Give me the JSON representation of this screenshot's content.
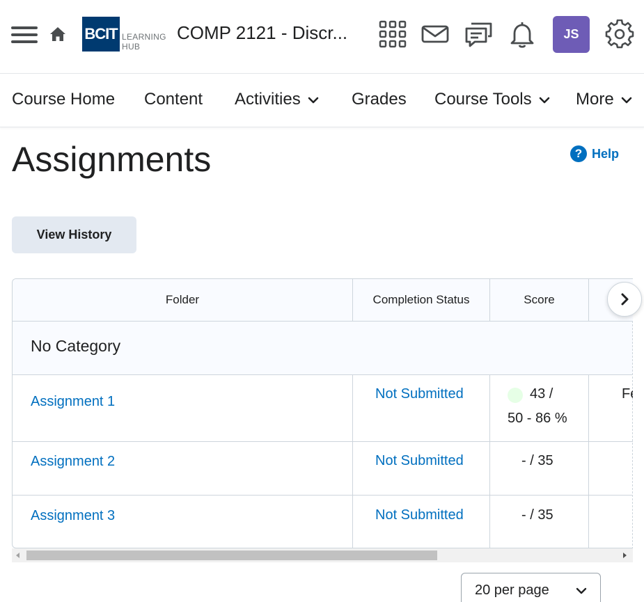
{
  "header": {
    "logo_mark": "BCIT",
    "logo_line1": "LEARNING",
    "logo_line2": "HUB",
    "course_title": "COMP 2121 - Discr...",
    "avatar_initials": "JS",
    "icons": [
      "menu-icon",
      "home-icon",
      "apps-grid-icon",
      "mail-icon",
      "chat-icon",
      "bell-icon",
      "gear-icon"
    ]
  },
  "nav": {
    "items": [
      {
        "label": "Course Home",
        "dropdown": false
      },
      {
        "label": "Content",
        "dropdown": false
      },
      {
        "label": "Activities",
        "dropdown": true
      },
      {
        "label": "Grades",
        "dropdown": false
      },
      {
        "label": "Course Tools",
        "dropdown": true
      },
      {
        "label": "More",
        "dropdown": true
      }
    ]
  },
  "page": {
    "title": "Assignments",
    "help_label": "Help",
    "view_history_label": "View History"
  },
  "table": {
    "headers": [
      "Folder",
      "Completion Status",
      "Score"
    ],
    "category": "No Category",
    "rows": [
      {
        "name": "Assignment 1",
        "status": "Not Submitted",
        "score_line1": "43 /",
        "score_line2": "50 - 86 %",
        "extra": "Fe"
      },
      {
        "name": "Assignment 2",
        "status": "Not Submitted",
        "score_line1": "- / 35"
      },
      {
        "name": "Assignment 3",
        "status": "Not Submitted",
        "score_line1": "- / 35"
      }
    ]
  },
  "pagination": {
    "per_page_selected": "20 per page"
  },
  "colors": {
    "link": "#006fbf",
    "avatar_bg": "#6e5cb6",
    "logo_bg": "#003a70",
    "button_bg": "#e3e9f1",
    "score_dot": "#e6ffe6"
  }
}
